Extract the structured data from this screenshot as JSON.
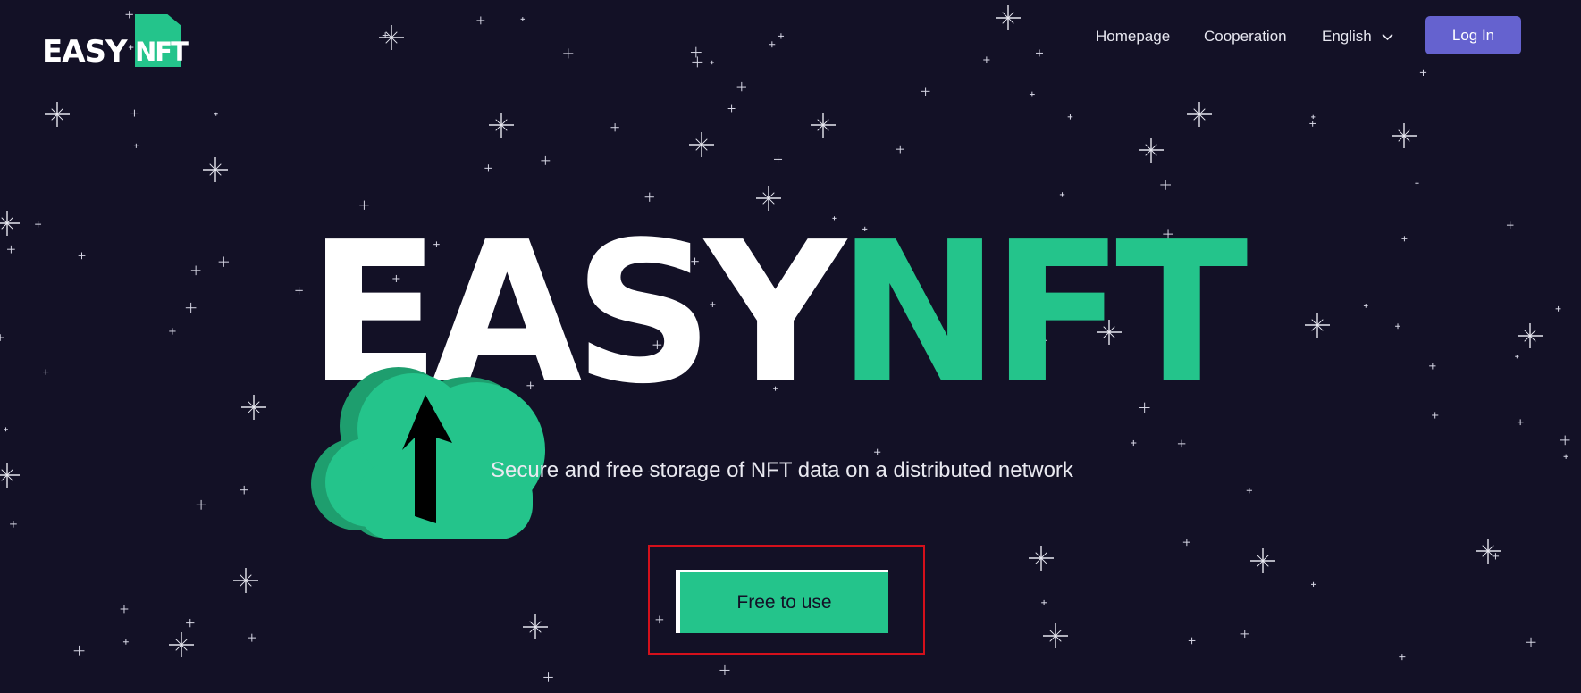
{
  "brand": {
    "easy": "EASY",
    "nft": "NFT"
  },
  "nav": {
    "links": [
      "Homepage",
      "Cooperation"
    ],
    "language": "English",
    "login": "Log In"
  },
  "hero": {
    "title_easy": "EASY",
    "title_nft": "NFT",
    "subtitle": "Secure and free storage of NFT data on a distributed network",
    "cta": "Free to use"
  },
  "colors": {
    "background": "#131126",
    "accent_green": "#24c48b",
    "login_button": "#6562cf",
    "highlight_box": "#d4101b"
  },
  "icons": [
    "logo-file-icon",
    "chevron-down-icon",
    "cloud-upload-icon",
    "sparkle-star-icon"
  ]
}
